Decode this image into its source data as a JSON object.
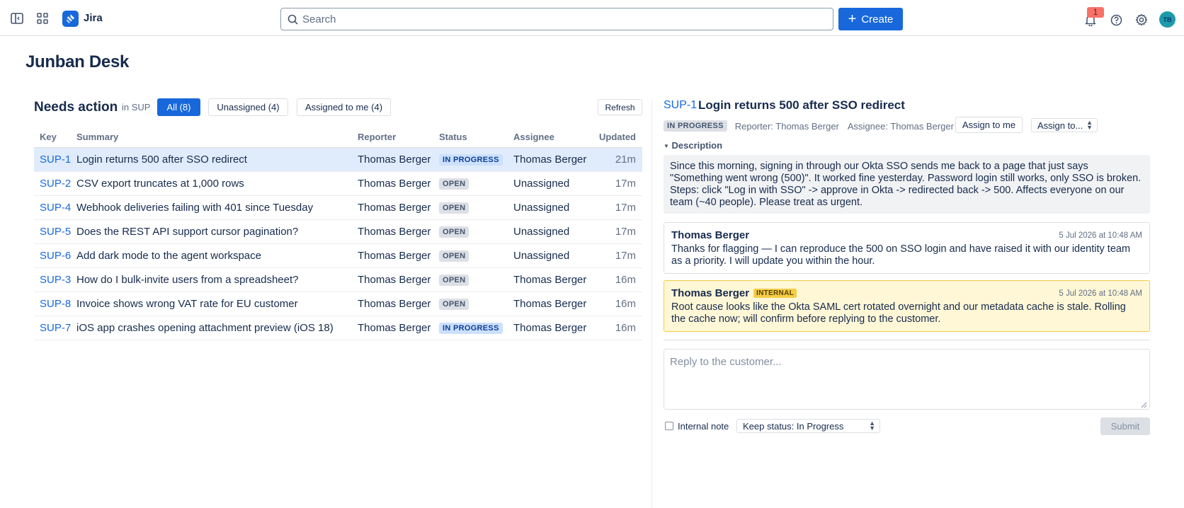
{
  "topbar": {
    "app_name": "Jira",
    "search_placeholder": "Search",
    "create_label": "Create",
    "notification_count": "1",
    "avatar_initials": "TB"
  },
  "page": {
    "title": "Junban Desk"
  },
  "queue": {
    "title": "Needs action",
    "project_scope": "in SUP",
    "filters": [
      {
        "label": "All (8)",
        "active": true
      },
      {
        "label": "Unassigned (4)",
        "active": false
      },
      {
        "label": "Assigned to me (4)",
        "active": false
      }
    ],
    "refresh_label": "Refresh",
    "columns": [
      "Key",
      "Summary",
      "Reporter",
      "Status",
      "Assignee",
      "Updated"
    ],
    "rows": [
      {
        "key": "SUP-1",
        "summary": "Login returns 500 after SSO redirect",
        "reporter": "Thomas Berger",
        "status": "IN PROGRESS",
        "assignee": "Thomas Berger",
        "updated": "21m"
      },
      {
        "key": "SUP-2",
        "summary": "CSV export truncates at 1,000 rows",
        "reporter": "Thomas Berger",
        "status": "OPEN",
        "assignee": "Unassigned",
        "updated": "17m"
      },
      {
        "key": "SUP-4",
        "summary": "Webhook deliveries failing with 401 since Tuesday",
        "reporter": "Thomas Berger",
        "status": "OPEN",
        "assignee": "Unassigned",
        "updated": "17m"
      },
      {
        "key": "SUP-5",
        "summary": "Does the REST API support cursor pagination?",
        "reporter": "Thomas Berger",
        "status": "OPEN",
        "assignee": "Unassigned",
        "updated": "17m"
      },
      {
        "key": "SUP-6",
        "summary": "Add dark mode to the agent workspace",
        "reporter": "Thomas Berger",
        "status": "OPEN",
        "assignee": "Unassigned",
        "updated": "17m"
      },
      {
        "key": "SUP-3",
        "summary": "How do I bulk-invite users from a spreadsheet?",
        "reporter": "Thomas Berger",
        "status": "OPEN",
        "assignee": "Thomas Berger",
        "updated": "16m"
      },
      {
        "key": "SUP-8",
        "summary": "Invoice shows wrong VAT rate for EU customer",
        "reporter": "Thomas Berger",
        "status": "OPEN",
        "assignee": "Thomas Berger",
        "updated": "16m"
      },
      {
        "key": "SUP-7",
        "summary": "iOS app crashes opening attachment preview (iOS 18)",
        "reporter": "Thomas Berger",
        "status": "IN PROGRESS",
        "assignee": "Thomas Berger",
        "updated": "16m"
      }
    ]
  },
  "detail": {
    "key": "SUP-1",
    "title": "Login returns 500 after SSO redirect",
    "status": "IN PROGRESS",
    "reporter": "Reporter: Thomas Berger",
    "assignee": "Assignee: Thomas Berger",
    "assign_me_label": "Assign to me",
    "assign_to_label": "Assign to...",
    "description_label": "Description",
    "description": "Since this morning, signing in through our Okta SSO sends me back to a page that just says \"Something went wrong (500)\". It worked fine yesterday. Password login still works, only SSO is broken. Steps: click \"Log in with SSO\" -> approve in Okta -> redirected back -> 500. Affects everyone on our team (~40 people). Please treat as urgent.",
    "comments": [
      {
        "author": "Thomas Berger",
        "time": "5 Jul 2026 at 10:48 AM",
        "body": "Thanks for flagging — I can reproduce the 500 on SSO login and have raised it with our identity team as a priority. I will update you within the hour.",
        "internal": false
      },
      {
        "author": "Thomas Berger",
        "tag": "INTERNAL",
        "time": "5 Jul 2026 at 10:48 AM",
        "body": "Root cause looks like the Okta SAML cert rotated overnight and our metadata cache is stale. Rolling the cache now; will confirm before replying to the customer.",
        "internal": true
      }
    ],
    "reply_placeholder": "Reply to the customer...",
    "internal_note_label": "Internal note",
    "status_select_value": "Keep status: In Progress",
    "submit_label": "Submit"
  },
  "colors": {
    "brand_blue": "#1868db",
    "unassigned_red": "#c9372c",
    "internal_yellow": "#fff7d6",
    "selected_row": "#e0ecfb"
  },
  "icons": [
    "sidebar-toggle-icon",
    "app-switcher-icon",
    "jira-logo-icon",
    "search-icon",
    "plus-icon",
    "bell-icon",
    "help-icon",
    "gear-icon",
    "chevron-down-icon",
    "resize-grip-icon"
  ]
}
